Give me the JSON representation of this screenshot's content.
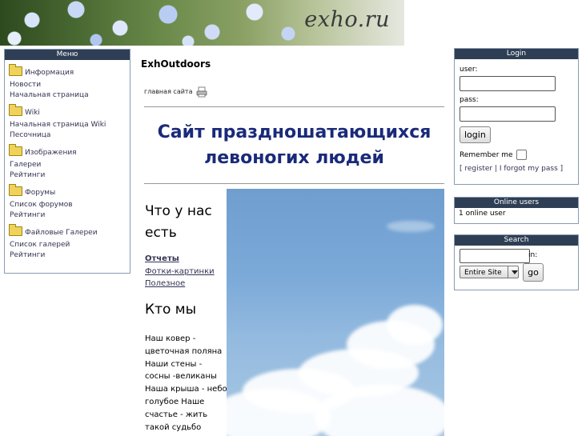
{
  "banner": {
    "logo_text": "exho.ru"
  },
  "menu": {
    "title": "Меню",
    "groups": [
      {
        "title": "Информация",
        "links": [
          "Новости",
          "Начальная страница"
        ]
      },
      {
        "title": "Wiki",
        "links": [
          "Начальная страница Wiki",
          "Песочница"
        ]
      },
      {
        "title": "Изображения",
        "links": [
          "Галереи",
          "Рейтинги"
        ]
      },
      {
        "title": "Форумы",
        "links": [
          "Список форумов",
          "Рейтинги"
        ]
      },
      {
        "title": "Файловые Галереи",
        "links": [
          "Список галерей",
          "Рейтинги"
        ]
      }
    ]
  },
  "main": {
    "site_name": "ExhOutdoors",
    "home_link": "главная сайта",
    "headline": "Сайт праздношатающихся левоногих людей",
    "what_title": "Что у нас есть",
    "links": [
      "Отчеты",
      "Фотки-картинки",
      "Полезное"
    ],
    "who_title": "Кто мы",
    "who_text": "Наш ковер - цветочная поляна Наши стены - сосны -великаны Наша крыша - небо голубое Наше счастье - жить такой судьбо"
  },
  "login": {
    "title": "Login",
    "user_label": "user:",
    "pass_label": "pass:",
    "button": "login",
    "remember_label": "Remember me",
    "register_link": "register",
    "forgot_link": "I forgot my pass",
    "user_value": "",
    "pass_value": ""
  },
  "online": {
    "title": "Online users",
    "text": "1 online user"
  },
  "search": {
    "title": "Search",
    "in_label": "in:",
    "scope": "Entire Site",
    "button": "go",
    "query": ""
  },
  "icons": {
    "folder": "folder-icon",
    "printer": "printer-icon"
  },
  "colors": {
    "box_header": "#2e3f55",
    "headline": "#1a2a7a",
    "link": "#333355"
  }
}
